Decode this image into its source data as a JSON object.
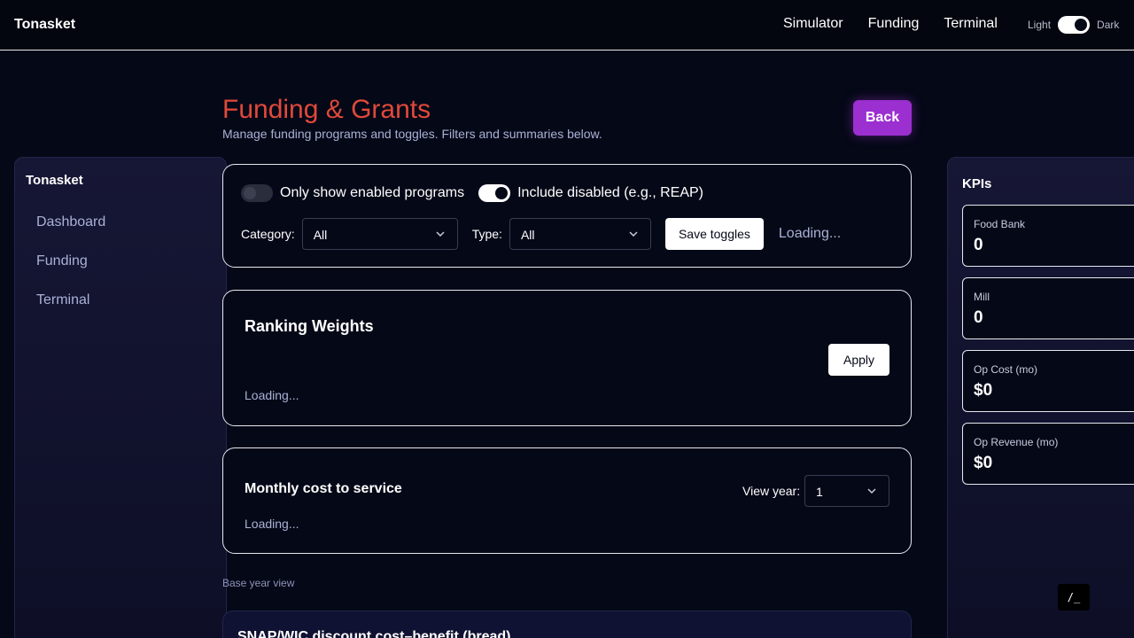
{
  "topnav": {
    "brand": "Tonasket",
    "links": [
      "Simulator",
      "Funding",
      "Terminal"
    ],
    "theme_light": "Light",
    "theme_dark": "Dark"
  },
  "sidebar": {
    "title": "Tonasket",
    "items": [
      {
        "label": "Dashboard"
      },
      {
        "label": "Funding"
      },
      {
        "label": "Terminal"
      }
    ]
  },
  "header": {
    "title": "Funding & Grants",
    "subtitle": "Manage funding programs and toggles. Filters and summaries below.",
    "back_label": "Back"
  },
  "filters": {
    "only_enabled_label": "Only show enabled programs",
    "only_enabled": false,
    "include_disabled_label": "Include disabled (e.g., REAP)",
    "include_disabled": true,
    "category_label": "Category:",
    "category_value": "All",
    "type_label": "Type:",
    "type_value": "All",
    "save_label": "Save toggles",
    "status": "Loading..."
  },
  "ranking": {
    "title": "Ranking Weights",
    "apply_label": "Apply",
    "status": "Loading..."
  },
  "monthly": {
    "title": "Monthly cost to service",
    "view_year_label": "View year:",
    "view_year_value": "1",
    "status": "Loading..."
  },
  "base_year_label": "Base year view",
  "snap": {
    "title": "SNAP/WIC discount cost–benefit (bread)"
  },
  "kpis": {
    "title": "KPIs",
    "cards": [
      {
        "label": "Food Bank",
        "value": "0"
      },
      {
        "label": "Mill",
        "value": "0"
      },
      {
        "label": "Op Cost (mo)",
        "value": "$0"
      },
      {
        "label": "Op Revenue (mo)",
        "value": "$0"
      }
    ]
  },
  "terminal_button": "/_",
  "colors": {
    "accent": "#9b2fd0",
    "title_red": "#e0493a",
    "background": "#050817"
  }
}
